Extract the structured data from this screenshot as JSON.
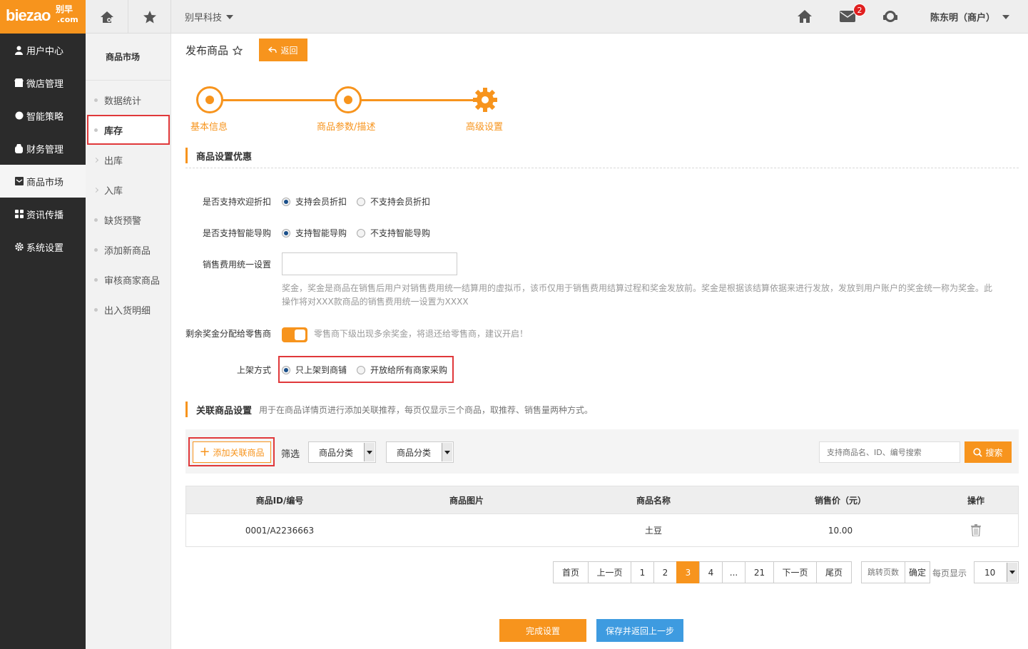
{
  "header": {
    "logo_main": "biezao",
    "logo_cn": "别早",
    "logo_com": ".com",
    "company": "别早科技",
    "mail_badge": "2",
    "user": "陈东明（商户）"
  },
  "sidebar": {
    "items": [
      {
        "label": "用户中心",
        "icon": "user-icon"
      },
      {
        "label": "微店管理",
        "icon": "shop-icon"
      },
      {
        "label": "智能策略",
        "icon": "strategy-icon"
      },
      {
        "label": "财务管理",
        "icon": "wallet-icon"
      },
      {
        "label": "商品市场",
        "icon": "market-icon"
      },
      {
        "label": "资讯传播",
        "icon": "grid-icon"
      },
      {
        "label": "系统设置",
        "icon": "gear-icon"
      }
    ]
  },
  "subnav": {
    "title": "商品市场",
    "items": [
      {
        "label": "数据统计"
      },
      {
        "label": "库存"
      },
      {
        "label": "出库"
      },
      {
        "label": "入库"
      },
      {
        "label": "缺货预警"
      },
      {
        "label": "添加新商品"
      },
      {
        "label": "审核商家商品"
      },
      {
        "label": "出入货明细"
      }
    ]
  },
  "page": {
    "title": "发布商品",
    "back": "返回"
  },
  "steps": [
    {
      "label": "基本信息"
    },
    {
      "label": "商品参数/描述"
    },
    {
      "label": "高级设置"
    }
  ],
  "section1": {
    "title": "商品设置优惠"
  },
  "form": {
    "discount_label": "是否支持欢迎折扣",
    "discount_yes": "支持会员折扣",
    "discount_no": "不支持会员折扣",
    "guide_label": "是否支持智能导购",
    "guide_yes": "支持智能导购",
    "guide_no": "不支持智能导购",
    "fee_label": "销售费用统一设置",
    "fee_hint_1": "奖金，奖金是商品在销售后用户对销售费用统一结算用的虚拟币，该币仅用于销售费用结算过程和奖金发放前。奖金是根据该结算依据来进行发放，发放到用户账户的奖金统一称为奖金。此",
    "fee_hint_2": "操作将对XXX款商品的销售费用统一设置为XXXX",
    "surplus_label": "剩余奖金分配给零售商",
    "surplus_hint": "零售商下级出现多余奖金，将退还给零售商，建议开启！",
    "shelf_label": "上架方式",
    "shelf_opt1": "只上架到商铺",
    "shelf_opt2": "开放给所有商家采购"
  },
  "section2": {
    "title": "关联商品设置",
    "desc": "用于在商品详情页进行添加关联推荐，每页仅显示三个商品，取推荐、销售量两种方式。"
  },
  "filter": {
    "add_label": "添加关联商品",
    "filter_label": "筛选",
    "select1": "商品分类",
    "select2": "商品分类",
    "search_placeholder": "支持商品名、ID、编号搜索",
    "search_btn": "搜索"
  },
  "table": {
    "headers": [
      "商品ID/编号",
      "商品图片",
      "商品名称",
      "销售价（元）",
      "操作"
    ],
    "rows": [
      {
        "id": "0001/A2236663",
        "name": "土豆",
        "price": "10.00"
      }
    ]
  },
  "pagination": {
    "first": "首页",
    "prev": "上一页",
    "pages": [
      "1",
      "2",
      "3",
      "4",
      "...",
      "21"
    ],
    "next": "下一页",
    "last": "尾页",
    "jump_placeholder": "跳转页数",
    "confirm": "确定",
    "per_page_label": "每页显示",
    "per_page": "10"
  },
  "actions": {
    "finish": "完成设置",
    "save_back": "保存并返回上一步"
  },
  "colors": {
    "accent": "#f7941d",
    "sidebar_bg": "#2b2b2b",
    "highlight_box": "#e0383a",
    "save_btn": "#3e9be0"
  }
}
